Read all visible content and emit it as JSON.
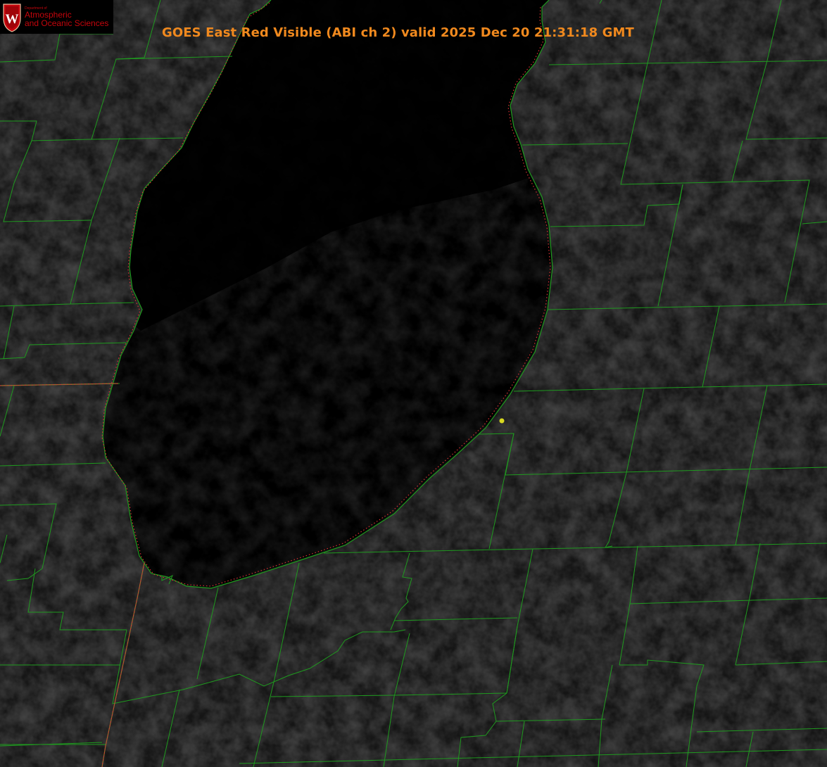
{
  "title": "GOES East Red Visible (ABI ch 2) valid 2025 Dec 20 21:31:18 GMT",
  "logo": {
    "department_small": "Department of",
    "line1": "Atmospheric",
    "line2": "and Oceanic Sciences",
    "seal_letter": "W"
  },
  "colors": {
    "title": "#f0891e",
    "county_lines": "#1f9a1f",
    "state_line": "#c83c3c",
    "shoreline_dotted": "#d23232",
    "station_marker": "#d8d820",
    "logo_red": "#c5050c",
    "lake_fill": "#000000",
    "land_fill": "#121212"
  },
  "features": {
    "lake": "lake",
    "station_marker": "station-marker",
    "state_border": "state-border",
    "county_grid": "county-grid"
  }
}
